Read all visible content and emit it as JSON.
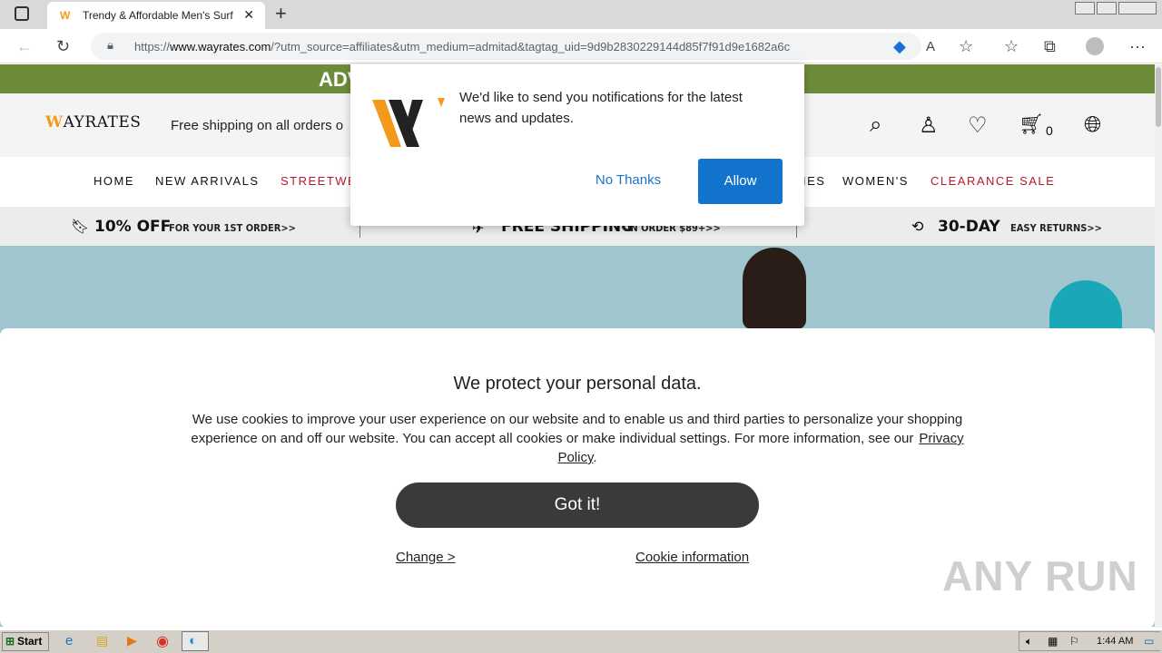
{
  "browser": {
    "tab_title": "Trendy & Affordable Men's Surf",
    "tab_close": "✕",
    "new_tab": "+",
    "url_prefix": "https://",
    "url_host": "www.wayrates.com",
    "url_rest": "/?utm_source=affiliates&utm_medium=admitad&tagtag_uid=9d9b2830229144d85f7f91d9e1682a6c"
  },
  "site": {
    "promo_text": "ADV",
    "logo": "AYRATES",
    "logo_w": "W",
    "shipping_text": "Free shipping on all orders o",
    "cart_count": "0",
    "nav": {
      "home": "HOME",
      "new_arrivals": "NEW ARRIVALS",
      "streetwear": "STREETWE",
      "accessories_tail": "IES",
      "womens": "WOMEN'S",
      "clearance": "CLEARANCE SALE"
    },
    "perks": {
      "p1_big": "10% OFF",
      "p1_small": "FOR YOUR 1ST ORDER>>",
      "p2_big": "FREE SHIPPING",
      "p2_small": "ON ORDER $89+>>",
      "p3_big": "30-DAY",
      "p3_small": "EASY RETURNS>>"
    }
  },
  "notification": {
    "text": "We'd like to send you notifications for the latest news and updates.",
    "no_thanks": "No Thanks",
    "allow": "Allow"
  },
  "cookie": {
    "title": "We protect your personal data.",
    "body": "We use cookies to improve your user experience on our website and to enable us and third parties to personalize your shopping experience on and off our website. You can accept all cookies or make individual settings. For more information, see our",
    "privacy_link": "Privacy Policy",
    "period": ".",
    "got_it": "Got it!",
    "change": "Change >",
    "cookie_info": "Cookie information"
  },
  "watermark": "ANY RUN",
  "taskbar": {
    "start": "Start",
    "clock": "1:44 AM"
  },
  "colors": {
    "promo_bg": "#6d8c3a",
    "allow_bg": "#1273cc",
    "got_it_bg": "#3a3a3a",
    "clearance_red": "#b51a2b",
    "logo_orange": "#f39a1b"
  }
}
